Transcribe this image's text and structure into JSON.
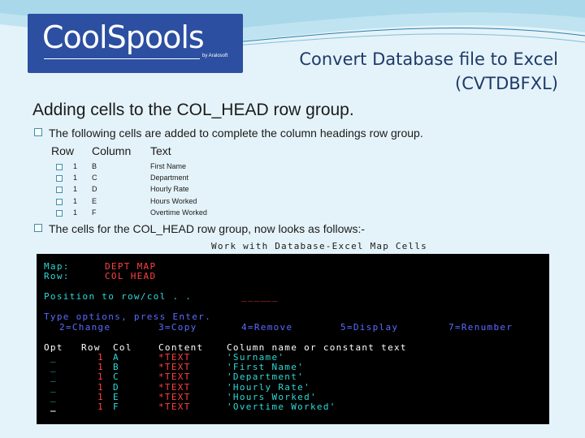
{
  "logo": {
    "text": "CoolSpools",
    "tagline": "by Aralosoft"
  },
  "title": {
    "line1": "Convert Database file to Excel",
    "line2": "(CVTDBFXL)"
  },
  "heading": "Adding cells to the COL_HEAD row group.",
  "intro": "The following cells are added to complete the column headings row group.",
  "cells_table": {
    "headers": [
      "Row",
      "Column",
      "Text"
    ],
    "rows": [
      {
        "row": "1",
        "column": "B",
        "text": "First Name"
      },
      {
        "row": "1",
        "column": "C",
        "text": "Department"
      },
      {
        "row": "1",
        "column": "D",
        "text": "Hourly Rate"
      },
      {
        "row": "1",
        "column": "E",
        "text": "Hours Worked"
      },
      {
        "row": "1",
        "column": "F",
        "text": "Overtime Worked"
      }
    ]
  },
  "followup": "The cells for the COL_HEAD row group, now looks as follows:-",
  "terminal": {
    "header": "Work with Database-Excel Map Cells",
    "map_label": "Map:",
    "map_value": "DEPT MAP",
    "row_label": "Row:",
    "row_value": "COL HEAD",
    "position_label": "Position to row/col  . .",
    "type_options": "Type options, press Enter.",
    "options": [
      "2=Change",
      "3=Copy",
      "4=Remove",
      "5=Display",
      "7=Renumber"
    ],
    "columns": [
      "Opt",
      "Row",
      "Col",
      "Content",
      "Column name or constant text"
    ],
    "rows": [
      {
        "opt": "_",
        "row": "1",
        "col": "A",
        "content": "*TEXT",
        "text": "'Surname'"
      },
      {
        "opt": "_",
        "row": "1",
        "col": "B",
        "content": "*TEXT",
        "text": "'First Name'"
      },
      {
        "opt": "_",
        "row": "1",
        "col": "C",
        "content": "*TEXT",
        "text": "'Department'"
      },
      {
        "opt": "_",
        "row": "1",
        "col": "D",
        "content": "*TEXT",
        "text": "'Hourly Rate'"
      },
      {
        "opt": "_",
        "row": "1",
        "col": "E",
        "content": "*TEXT",
        "text": "'Hours Worked'"
      },
      {
        "opt": "_",
        "row": "1",
        "col": "F",
        "content": "*TEXT",
        "text": "'Overtime Worked'"
      }
    ]
  },
  "colors": {
    "background": "#e4f3f9",
    "logo_bg": "#2c4fa1",
    "title": "#1f3a6a",
    "terminal_bg": "#000000",
    "terminal_cyan": "#2fd8d8",
    "terminal_blue": "#5a6cff",
    "terminal_red": "#ff4040"
  }
}
